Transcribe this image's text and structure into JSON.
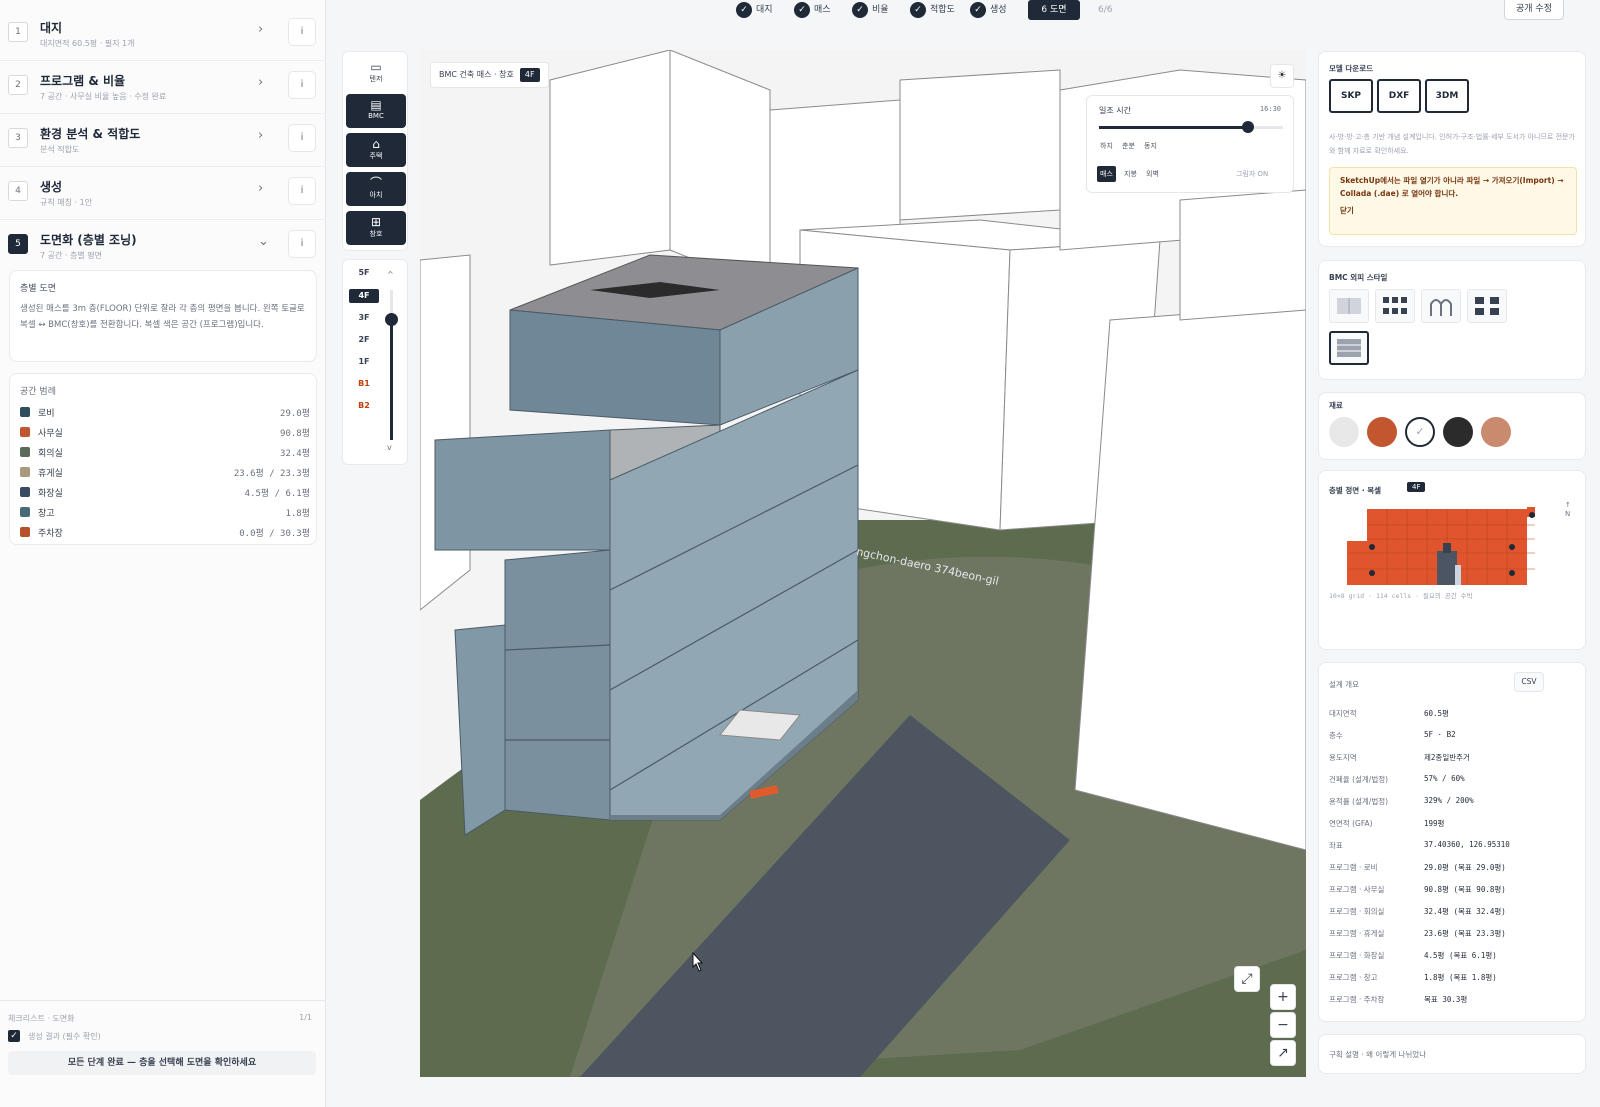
{
  "steps": [
    {
      "num": "1",
      "title": "대지",
      "sub": "대지면적 60.5평 · 필지 1개"
    },
    {
      "num": "2",
      "title": "프로그램 & 비율",
      "sub": "7 공간 · 사무실 비율 높음 · 수정 완료"
    },
    {
      "num": "3",
      "title": "환경 분석 & 적합도",
      "sub": "분석 적합도"
    },
    {
      "num": "4",
      "title": "생성",
      "sub": "규칙 매칭 · 1안"
    },
    {
      "num": "5",
      "title": "도면화 (층별 조닝)",
      "sub": "7 공간 · 층별 평면"
    }
  ],
  "step_info": "i",
  "floor_plan": {
    "heading": "층별 도면",
    "body": "생성된 매스를 3m 층(FLOOR) 단위로 잘라 각 층의 평면을 봅니다. 왼쪽 토글로 복셀 ↔ BMC(창호)를 전환합니다. 복셀 색은 공간 (프로그램)입니다."
  },
  "legend": {
    "heading": "공간 범례",
    "items": [
      {
        "name": "로비",
        "value": "29.0평",
        "color": "#2f4f5f"
      },
      {
        "name": "사무실",
        "value": "90.8평",
        "color": "#c2562e"
      },
      {
        "name": "회의실",
        "value": "32.4평",
        "color": "#5b6b57"
      },
      {
        "name": "휴게실",
        "value": "23.6평 / 23.3평",
        "color": "#a89a7a"
      },
      {
        "name": "화장실",
        "value": "4.5평 / 6.1평",
        "color": "#3b4a63"
      },
      {
        "name": "창고",
        "value": "1.8평",
        "color": "#4a6a78"
      },
      {
        "name": "주차장",
        "value": "0.0평 / 30.3평",
        "color": "#b5502b"
      }
    ]
  },
  "checklist": {
    "heading": "체크리스트 · 도면화",
    "count": "1/1",
    "check_mark": "✓",
    "item": "생성 결과 (필수 확인)",
    "done_text": "모든 단계 완료 — 층을 선택해 도면을 확인하세요"
  },
  "topbar": {
    "pills": [
      "대지",
      "매스",
      "비율",
      "적합도",
      "생성"
    ],
    "active": "6 도면",
    "count": "6/6",
    "edit": "공개 수정",
    "check_mark": "✓"
  },
  "tools": [
    {
      "icon": "▭",
      "label": "텐저",
      "style": "light"
    },
    {
      "icon": "▤",
      "label": "BMC",
      "style": "dark"
    },
    {
      "icon": "⌂",
      "label": "주택",
      "style": "dark"
    },
    {
      "icon": "⌒",
      "label": "아치",
      "style": "dark"
    },
    {
      "icon": "⊞",
      "label": "창호",
      "style": "dark"
    }
  ],
  "floors": {
    "items": [
      "5F",
      "4F",
      "3F",
      "2F",
      "1F",
      "B1",
      "B2"
    ],
    "selected": "4F",
    "up": "^",
    "down": "v"
  },
  "viewport": {
    "label": "BMC 건축 매스 · 창호",
    "floor_badge": "4F",
    "sun": {
      "title": "일조 시간",
      "time": "16:30",
      "seasons": [
        "하지",
        "춘분",
        "동지"
      ],
      "views": [
        "매스",
        "지붕",
        "외벽"
      ],
      "note": "그림자 ON"
    },
    "sun_icon": "☀",
    "road_label": "ngchon-daero 374beon-gil",
    "controls": {
      "fit": "⤢",
      "zoom_in": "+",
      "zoom_out": "−",
      "compass": "↗"
    }
  },
  "downloads": {
    "heading": "모델 다운로드",
    "buttons": [
      "SKP",
      "DXF",
      "3DM"
    ],
    "note": "사·방·방·고·층 기반 개념 설계입니다. 인허가·구조·법률·세부 도서가 아니므로 전문가와 함께 자료로 확인하세요.",
    "tip": "SketchUp에서는 파일 열기가 아니라 파일 → 가져오기(Import) → Collada (.dae) 로 열어야 합니다.",
    "tip_close": "닫기"
  },
  "bmc_style": {
    "heading": "BMC 외피 스타일"
  },
  "materials": {
    "heading": "재료",
    "colors": [
      "#e8e8e8",
      "#c2562e",
      "#ffffff",
      "#2b2b2b",
      "#c98a6e"
    ],
    "selected_mark": "✓"
  },
  "elevation": {
    "heading": "층별 정면 · 복셀",
    "badge": "4F",
    "axis": "↑ N",
    "note": "10×8 grid · 114 cells · 필요의 공간 수박"
  },
  "overview": {
    "heading": "설계 개요",
    "csv": "CSV",
    "rows": [
      {
        "k": "대지면적",
        "v": "60.5평"
      },
      {
        "k": "층수",
        "v": "5F · B2"
      },
      {
        "k": "용도지역",
        "v": "제2종일반주거"
      },
      {
        "k": "건폐율 (설계/법정)",
        "v": "57% / 60%"
      },
      {
        "k": "용적률 (설계/법정)",
        "v": "329% / 200%"
      },
      {
        "k": "연면적 (GFA)",
        "v": "199평"
      },
      {
        "k": "좌표",
        "v": "37.40360, 126.95310"
      },
      {
        "k": "프로그램 · 로비",
        "v": "29.0평 (목표 29.0평)"
      },
      {
        "k": "프로그램 · 사무실",
        "v": "90.8평 (목표 90.8평)"
      },
      {
        "k": "프로그램 · 회의실",
        "v": "32.4평 (목표 32.4평)"
      },
      {
        "k": "프로그램 · 휴게실",
        "v": "23.6평 (목표 23.3평)"
      },
      {
        "k": "프로그램 · 화장실",
        "v": "4.5평 (목표 6.1평)"
      },
      {
        "k": "프로그램 · 창고",
        "v": "1.8평 (목표 1.8평)"
      },
      {
        "k": "프로그램 · 주차장",
        "v": "목표 30.3평"
      }
    ]
  },
  "structure": {
    "heading": "구획 설명 · 왜 이렇게 나뉘었나"
  }
}
